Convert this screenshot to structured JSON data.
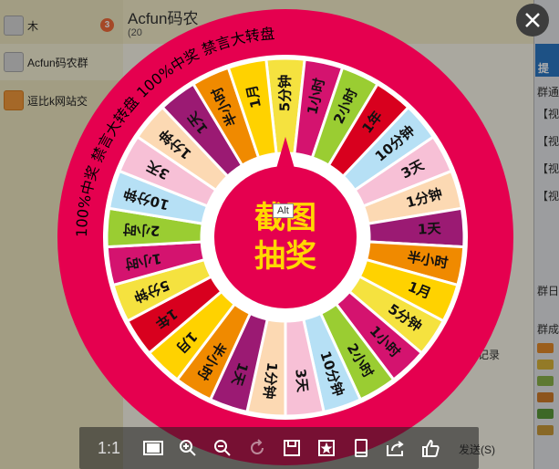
{
  "chat": {
    "title": "Acfun码农",
    "subtitle": "(20",
    "message_log_label": "消息记录",
    "send_label": "发送(S)"
  },
  "sidebar": {
    "items": [
      {
        "label": "木",
        "badge": "3"
      },
      {
        "label": "Acfun码农群"
      },
      {
        "label": "逗比k网站交"
      }
    ]
  },
  "right_panel": {
    "button_label": "提",
    "items": [
      "群通",
      "【视",
      "【视",
      "【视",
      "【视",
      "群日",
      "群成"
    ]
  },
  "wheel": {
    "ring_text": "100%中奖  禁言大转盘  100%中奖  禁言大转盘",
    "center_line1": "截图",
    "center_line2": "抽奖",
    "segments": [
      {
        "label": "5分钟",
        "color": "#f5e23f"
      },
      {
        "label": "1小时",
        "color": "#d4136f"
      },
      {
        "label": "2小时",
        "color": "#9acd32"
      },
      {
        "label": "1年",
        "color": "#d8001e"
      },
      {
        "label": "10分钟",
        "color": "#b6e0f5"
      },
      {
        "label": "3天",
        "color": "#f7c0d6"
      },
      {
        "label": "1分钟",
        "color": "#fcd9b3"
      },
      {
        "label": "1天",
        "color": "#9b1a73"
      },
      {
        "label": "半小时",
        "color": "#f08a00"
      },
      {
        "label": "1月",
        "color": "#ffd200"
      },
      {
        "label": "5分钟",
        "color": "#f5e23f"
      },
      {
        "label": "1小时",
        "color": "#d4136f"
      },
      {
        "label": "2小时",
        "color": "#9acd32"
      },
      {
        "label": "10分钟",
        "color": "#b6e0f5"
      },
      {
        "label": "3天",
        "color": "#f7c0d6"
      },
      {
        "label": "1分钟",
        "color": "#fcd9b3"
      },
      {
        "label": "1天",
        "color": "#9b1a73"
      },
      {
        "label": "半小时",
        "color": "#f08a00"
      },
      {
        "label": "1月",
        "color": "#ffd200"
      },
      {
        "label": "1年",
        "color": "#d8001e"
      },
      {
        "label": "5分钟",
        "color": "#f5e23f"
      },
      {
        "label": "1小时",
        "color": "#d4136f"
      },
      {
        "label": "2小时",
        "color": "#9acd32"
      },
      {
        "label": "10分钟",
        "color": "#b6e0f5"
      },
      {
        "label": "3天",
        "color": "#f7c0d6"
      },
      {
        "label": "1分钟",
        "color": "#fcd9b3"
      },
      {
        "label": "1天",
        "color": "#9b1a73"
      },
      {
        "label": "半小时",
        "color": "#f08a00"
      },
      {
        "label": "1月",
        "color": "#ffd200"
      }
    ],
    "ring_color": "#e5004f",
    "center_color": "#e5004f"
  },
  "tooltip": {
    "text": "Alt"
  },
  "toolbar": {
    "zoom_ratio": "1:1",
    "buttons": [
      "fit-screen-icon",
      "zoom-in-icon",
      "zoom-out-icon",
      "rotate-icon",
      "save-icon",
      "favorite-icon",
      "phone-icon",
      "share-icon",
      "like-icon"
    ]
  }
}
